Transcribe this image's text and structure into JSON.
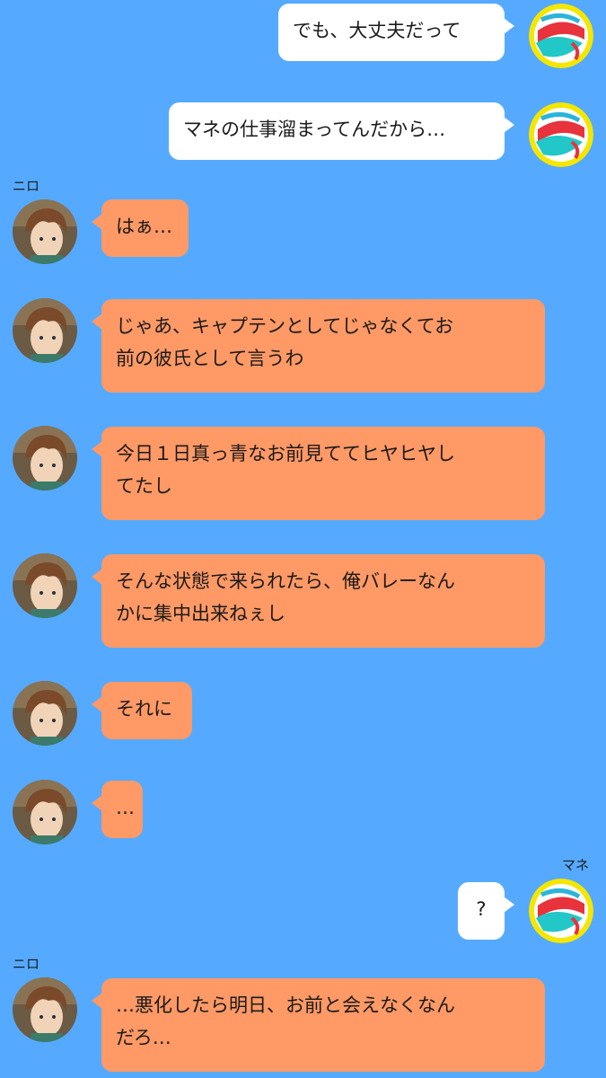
{
  "colors": {
    "background": "#55aaff",
    "partner_bubble": "#ff9966",
    "self_bubble": "#ffffff"
  },
  "icons": {
    "partner_avatar": "boy-character-avatar-icon",
    "self_avatar": "volleyball-avatar-icon"
  },
  "messages": [
    {
      "side": "right",
      "text": "でも、大丈夫だって"
    },
    {
      "side": "right",
      "text": "マネの仕事溜まってんだから…"
    },
    {
      "side": "left",
      "sender": "ニロ",
      "text": "はぁ…"
    },
    {
      "side": "left",
      "text": "じゃあ、キャプテンとしてじゃなくてお\n前の彼氏として言うわ"
    },
    {
      "side": "left",
      "text": "今日１日真っ青なお前見ててヒヤヒヤし\nてたし"
    },
    {
      "side": "left",
      "text": "そんな状態で来られたら、俺バレーなん\nかに集中出来ねぇし"
    },
    {
      "side": "left",
      "text": "それに"
    },
    {
      "side": "left",
      "text": "…"
    },
    {
      "side": "right",
      "sender": "マネ",
      "text": "?"
    },
    {
      "side": "left",
      "sender": "ニロ",
      "text": "…悪化したら明日、お前と会えなくなん\nだろ…"
    }
  ]
}
